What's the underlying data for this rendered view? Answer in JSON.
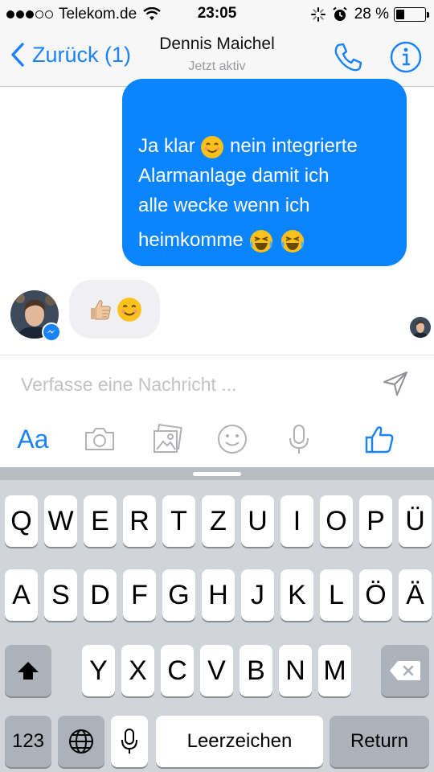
{
  "status_bar": {
    "carrier": "Telekom.de",
    "time": "23:05",
    "battery_percent": "28 %",
    "battery_level": 0.28,
    "signal_bars_filled": 3,
    "signal_bars_total": 5
  },
  "nav": {
    "back_label": "Zurück (1)",
    "contact_name": "Dennis Maichel",
    "status": "Jetzt aktiv"
  },
  "messages": {
    "outgoing": {
      "line1_before": "Ja klar",
      "line1_after": "nein integrierte",
      "line2": "Alarmanlage damit ich",
      "line3": "alle wecke wenn ich",
      "line4": "heimkomme"
    }
  },
  "composer": {
    "placeholder": "Verfasse eine Nachricht ..."
  },
  "toolbar": {
    "text_label": "Aa"
  },
  "keyboard": {
    "row1": [
      "Q",
      "W",
      "E",
      "R",
      "T",
      "Z",
      "U",
      "I",
      "O",
      "P",
      "Ü"
    ],
    "row2": [
      "A",
      "S",
      "D",
      "F",
      "G",
      "H",
      "J",
      "K",
      "L",
      "Ö",
      "Ä"
    ],
    "row3": [
      "Y",
      "X",
      "C",
      "V",
      "B",
      "N",
      "M"
    ],
    "numbers_label": "123",
    "space_label": "Leerzeichen",
    "return_label": "Return"
  },
  "colors": {
    "accent": "#1a82fb",
    "outgoing_bubble": "#0b84ff",
    "incoming_bubble": "#f0f0f2",
    "keyboard_bg": "#d1d4d9"
  }
}
